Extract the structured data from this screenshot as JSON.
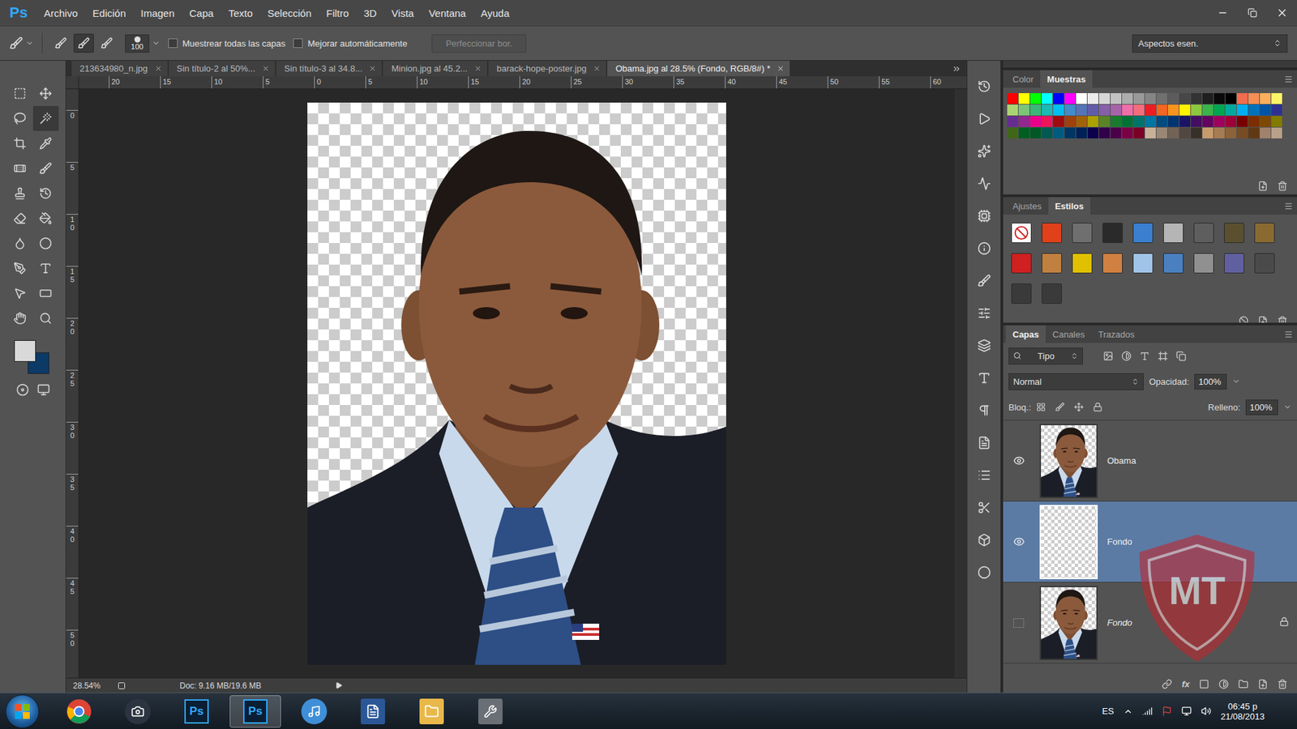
{
  "app": {
    "logo": "Ps"
  },
  "menu": [
    "Archivo",
    "Edición",
    "Imagen",
    "Capa",
    "Texto",
    "Selección",
    "Filtro",
    "3D",
    "Vista",
    "Ventana",
    "Ayuda"
  ],
  "options_bar": {
    "brush_size": "100",
    "brush_modes": [
      {
        "selected": false
      },
      {
        "selected": true
      },
      {
        "selected": false
      }
    ],
    "checkboxes": [
      {
        "label": "Muestrear todas las capas",
        "checked": false
      },
      {
        "label": "Mejorar automáticamente",
        "checked": false
      }
    ],
    "button": {
      "label": "Perfeccionar bor.",
      "disabled": true
    },
    "workspace": "Aspectos esen."
  },
  "tools": [
    {
      "selected": false
    },
    {
      "selected": false
    },
    {
      "selected": false
    },
    {
      "selected": true
    },
    {
      "selected": false
    },
    {
      "selected": false
    },
    {
      "selected": false
    },
    {
      "selected": false
    },
    {
      "selected": false
    },
    {
      "selected": false
    },
    {
      "selected": false
    },
    {
      "selected": false
    },
    {
      "selected": false
    },
    {
      "selected": false
    },
    {
      "selected": false
    },
    {
      "selected": false
    },
    {
      "selected": false
    },
    {
      "selected": false
    },
    {
      "selected": false
    },
    {
      "selected": false
    }
  ],
  "colors": {
    "foreground": "#d9d9d9",
    "background": "#0b3a66"
  },
  "tabs": [
    {
      "label": "213634980_n.jpg",
      "selected": false
    },
    {
      "label": "Sin título-2 al 50%...",
      "selected": false
    },
    {
      "label": "Sin título-3 al 34.8...",
      "selected": false
    },
    {
      "label": "Minion.jpg al 45.2...",
      "selected": false
    },
    {
      "label": "barack-hope-poster.jpg",
      "selected": false
    },
    {
      "label": "Obama.jpg al 28.5% (Fondo, RGB/8#) *",
      "selected": true
    }
  ],
  "rulers": {
    "horizontal": [
      "20",
      "15",
      "10",
      "5",
      "0",
      "5",
      "10",
      "15",
      "20",
      "25",
      "30",
      "35",
      "40",
      "45",
      "50",
      "55",
      "60"
    ],
    "vertical": [
      "0",
      "5",
      "10",
      "15",
      "20",
      "25",
      "30",
      "35",
      "40",
      "45",
      "50"
    ]
  },
  "document": {
    "zoom": "28.54%",
    "doc_size": "Doc: 9.16 MB/19.6 MB"
  },
  "panels": {
    "color": {
      "tabs": [
        {
          "label": "Color",
          "selected": false
        },
        {
          "label": "Muestras",
          "selected": true
        }
      ],
      "swatches": [
        "#ff0000",
        "#ffff00",
        "#00ff00",
        "#00ffff",
        "#0000ff",
        "#ff00ff",
        "#ffffff",
        "#ebebeb",
        "#d6d6d6",
        "#c2c2c2",
        "#adadad",
        "#999999",
        "#858585",
        "#707070",
        "#5c5c5c",
        "#474747",
        "#333333",
        "#1f1f1f",
        "#0a0a0a",
        "#000000",
        "#f26c4f",
        "#f68e55",
        "#fbaf5c",
        "#fff467",
        "#acd372",
        "#7cc576",
        "#3bb878",
        "#1abbb4",
        "#00bff3",
        "#438ccb",
        "#5574b9",
        "#605ca8",
        "#855fa8",
        "#a763a8",
        "#f06ea9",
        "#f26d7d",
        "#ed1c24",
        "#f26522",
        "#f7941d",
        "#fff200",
        "#8dc73f",
        "#39b54a",
        "#00a650",
        "#00a99e",
        "#00aeef",
        "#0072bc",
        "#0054a5",
        "#2e3192",
        "#662d91",
        "#92278f",
        "#ec008c",
        "#ed145b",
        "#9e0b0f",
        "#a0410d",
        "#a36209",
        "#aba000",
        "#598527",
        "#1a7b30",
        "#007236",
        "#00746b",
        "#0076a3",
        "#004b80",
        "#003471",
        "#1b1464",
        "#440e62",
        "#630460",
        "#9e005d",
        "#9e0039",
        "#790000",
        "#7b2e00",
        "#7d4900",
        "#827b00",
        "#406618",
        "#005e20",
        "#005826",
        "#005952",
        "#005b7f",
        "#003663",
        "#002157",
        "#0d004c",
        "#32004b",
        "#4b0049",
        "#7b0046",
        "#7a0026",
        "#c7b299",
        "#998675",
        "#736357",
        "#534741",
        "#37302a",
        "#c69c6d",
        "#a67c52",
        "#8c6239",
        "#754c24",
        "#603913",
        "#a0826d",
        "#b8a08a"
      ]
    },
    "styles": {
      "tabs": [
        {
          "label": "Ajustes",
          "selected": false
        },
        {
          "label": "Estilos",
          "selected": true
        }
      ],
      "items": [
        {
          "color": "#ffffff"
        },
        {
          "color": "#e0401a"
        },
        {
          "color": "#6f6f6f"
        },
        {
          "color": "#2a2a2a"
        },
        {
          "color": "#3a7fd0"
        },
        {
          "color": "#b5b5b5"
        },
        {
          "color": "#5e5e5e"
        },
        {
          "color": "#5a5030"
        },
        {
          "color": "#8a6a30"
        },
        {
          "color": "#d02020"
        },
        {
          "color": "#c08040"
        },
        {
          "color": "#e0c000"
        },
        {
          "color": "#d08040"
        },
        {
          "color": "#a0c4e8"
        },
        {
          "color": "#4a80c0"
        },
        {
          "color": "#909090"
        },
        {
          "color": "#6060a0"
        },
        {
          "color": "#4a4a4a"
        },
        {
          "color": "#3a3a3a"
        },
        {
          "color": "#3a3a3a"
        }
      ]
    },
    "layers": {
      "tabs": [
        {
          "label": "Capas",
          "selected": true
        },
        {
          "label": "Canales",
          "selected": false
        },
        {
          "label": "Trazados",
          "selected": false
        }
      ],
      "filter": "Tipo",
      "blend_mode": "Normal",
      "opacity_label": "Opacidad:",
      "opacity": "100%",
      "lock_label": "Bloq.:",
      "fill_label": "Relleno:",
      "fill": "100%",
      "fx": "fx",
      "items": [
        {
          "name": "Obama",
          "visible": true,
          "selected": false,
          "locked": false,
          "italic": false,
          "kind": "photo"
        },
        {
          "name": "Fondo",
          "visible": true,
          "selected": true,
          "locked": false,
          "italic": false,
          "kind": "empty"
        },
        {
          "name": "Fondo",
          "visible": false,
          "selected": false,
          "locked": true,
          "italic": true,
          "kind": "photo"
        }
      ]
    }
  },
  "watermark": {
    "text": "MT"
  },
  "taskbar": {
    "apps": [
      {
        "kind": "chrome",
        "selected": false
      },
      {
        "kind": "camera",
        "selected": false
      },
      {
        "kind": "ps",
        "label": "Ps",
        "selected": false
      },
      {
        "kind": "ps",
        "label": "Ps",
        "selected": true
      },
      {
        "kind": "music",
        "selected": false
      },
      {
        "kind": "word",
        "selected": false
      },
      {
        "kind": "folder",
        "selected": false
      },
      {
        "kind": "tool",
        "selected": false
      }
    ],
    "language": "ES",
    "time": "06:45 p",
    "date": "21/08/2013"
  }
}
